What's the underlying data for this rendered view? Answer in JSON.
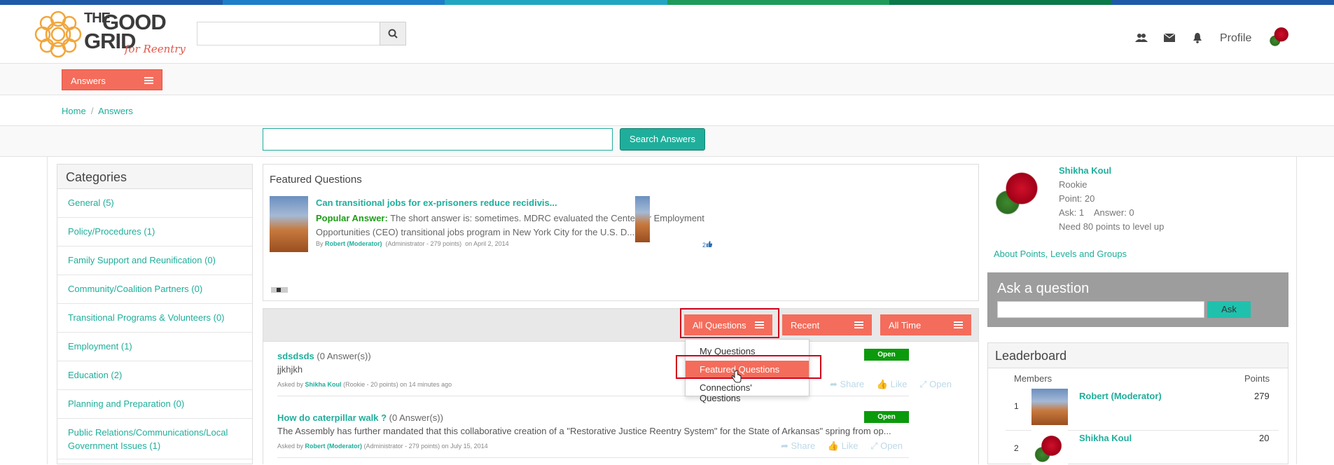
{
  "colors": {
    "stripe": [
      "#1e5aa8",
      "#1e7ec8",
      "#21a6c2",
      "#1e9a5a",
      "#0b7a4a",
      "#1e5aa8"
    ],
    "accent": "#f46c5b",
    "link": "#1fae9b",
    "open_badge": "#0b9a0b"
  },
  "logo": {
    "line1": "THE",
    "line2": "GOOD",
    "line3": "GRID",
    "tagline": "for Reentry"
  },
  "header": {
    "search_placeholder": "",
    "icons": [
      "users-icon",
      "envelope-icon",
      "bell-icon"
    ],
    "profile": "Profile"
  },
  "nav": {
    "answers_label": "Answers"
  },
  "breadcrumb": {
    "home": "Home",
    "sep": "/",
    "current": "Answers"
  },
  "answer_search": {
    "value": "",
    "button": "Search Answers"
  },
  "categories": {
    "title": "Categories",
    "items": [
      "General (5)",
      "Policy/Procedures (1)",
      "Family Support and Reunification (0)",
      "Community/Coalition Partners (0)",
      "Transitional Programs & Volunteers (0)",
      "Employment (1)",
      "Education (2)",
      "Planning and Preparation (0)",
      "Public Relations/Communications/Local Government Issues (1)"
    ]
  },
  "featured": {
    "title": "Featured Questions",
    "question": "Can transitional jobs for ex-prisoners reduce recidivis...",
    "popular_label": "Popular Answer:",
    "popular_text": "The short answer is: sometimes. MDRC evaluated the Center for Employment Opportunities (CEO) transitional jobs program in New York City for the U.S. D...",
    "by_prefix": "By",
    "author": "Robert (Moderator)",
    "author_meta": "(Administrator - 279 points)",
    "date": "on April 2, 2014",
    "likes": "2"
  },
  "filters": {
    "all_questions": "All Questions",
    "recent": "Recent",
    "all_time": "All Time"
  },
  "dropdown": {
    "items": [
      "My Questions",
      "Featured Questions",
      "Connections' Questions"
    ],
    "active": "Featured Questions"
  },
  "questions": [
    {
      "title": "sdsdsds",
      "answers": "(0 Answer(s))",
      "body": "jjkhjkh",
      "asked_by": "Asked by",
      "author": "Shikha Koul",
      "meta": "(Rookie - 20 points) on 14 minutes ago",
      "status": "Open",
      "share": "Share",
      "like": "Like",
      "open": "Open"
    },
    {
      "title": "How do caterpillar walk ?",
      "answers": "(0 Answer(s))",
      "body": "The Assembly has further mandated that this collaborative creation of a \"Restorative Justice Reentry System\" for the State of Arkansas\" spring from op...",
      "asked_by": "Asked by",
      "author": "Robert (Moderator)",
      "meta": "(Administrator - 279 points) on July 15, 2014",
      "status": "Open",
      "share": "Share",
      "like": "Like",
      "open": "Open"
    }
  ],
  "user": {
    "name": "Shikha Koul",
    "level": "Rookie",
    "points": "Point: 20",
    "ask_answer": "Ask: 1    Answer: 0",
    "next": "Need 80 points to level up",
    "about_link": "About Points, Levels and Groups"
  },
  "ask": {
    "title": "Ask a question",
    "value": "",
    "button": "Ask"
  },
  "leaderboard": {
    "title": "Leaderboard",
    "col_members": "Members",
    "col_points": "Points",
    "rows": [
      {
        "rank": "1",
        "name": "Robert (Moderator)",
        "points": "279"
      },
      {
        "rank": "2",
        "name": "Shikha Koul",
        "points": "20"
      }
    ]
  }
}
